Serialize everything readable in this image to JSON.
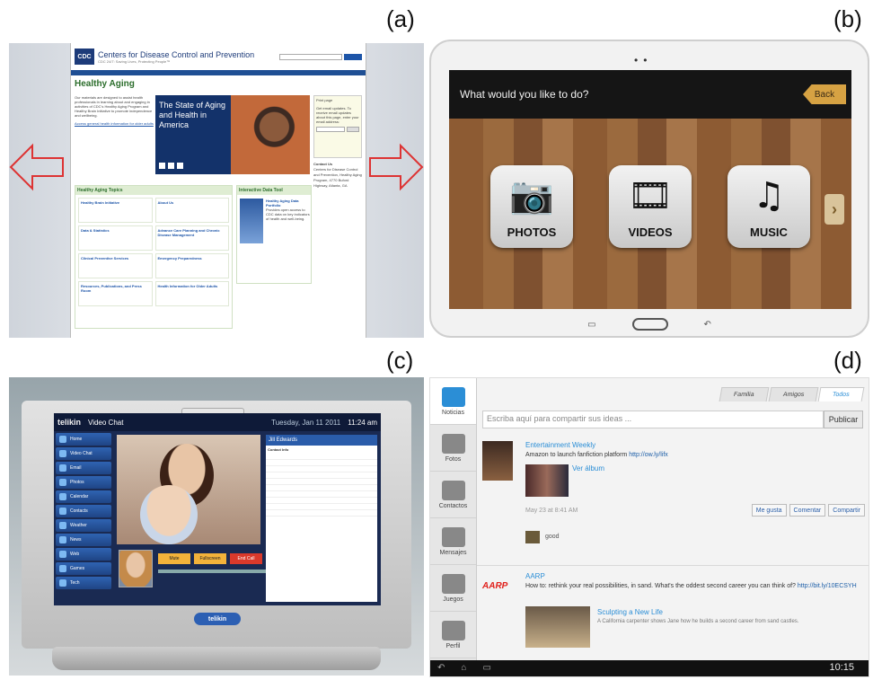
{
  "labels": {
    "a": "(a)",
    "b": "(b)",
    "c": "(c)",
    "d": "(d)"
  },
  "panel_a": {
    "site_title": "Centers for Disease Control and Prevention",
    "tagline": "CDC 24/7: Saving Lives, Protecting People™",
    "logo_text": "CDC",
    "page_heading": "Healthy Aging",
    "banner_title": "The State of Aging and Health in America",
    "topics_heading": "Healthy Aging Topics",
    "tool_heading": "Interactive Data Tool",
    "topics": [
      "Healthy Brain Initiative",
      "About Us",
      "Data & Statistics",
      "Advance Care Planning and Chronic Disease Management",
      "Clinical Preventive Services",
      "Emergency Preparedness",
      "Resources, Publications, and Press Room",
      "Health Information for Older Adults"
    ],
    "tool_item": "Healthy Aging Data Portfolio",
    "side_title": "Print page",
    "side_submit": "Submit",
    "contact_title": "Contact Us"
  },
  "panel_b": {
    "question": "What would you like to do?",
    "back": "Back",
    "tiles": [
      {
        "label": "PHOTOS",
        "glyph": "📷"
      },
      {
        "label": "VIDEOS",
        "glyph": "🎞"
      },
      {
        "label": "MUSIC",
        "glyph": "♫"
      }
    ],
    "next": "›"
  },
  "panel_c": {
    "logo": "telikin",
    "screen_title": "Video Chat",
    "date": "Tuesday, Jan 11 2011",
    "time": "11:24 am",
    "menu": [
      "Home",
      "Video Chat",
      "Email",
      "Photos",
      "Calendar",
      "Contacts",
      "Weather",
      "News",
      "Web",
      "Games",
      "Tech"
    ],
    "buttons": [
      "Mute",
      "Fullscreen",
      "End Call"
    ],
    "contact_name": "Jill Edwards",
    "contact_section": "Contact Info",
    "bottom_logo": "telikin"
  },
  "panel_d": {
    "tabs": [
      "Familia",
      "Amigos",
      "Todos"
    ],
    "compose_placeholder": "Escriba aquí para compartir sus ideas ...",
    "publish": "Publicar",
    "sidebar": [
      "Noticias",
      "Fotos",
      "Contactos",
      "Mensajes",
      "Juegos",
      "Perfil"
    ],
    "post1": {
      "author": "Entertainment Weekly",
      "text": "Amazon to launch fanfiction platform",
      "link": "http://ow.ly/lifx",
      "album": "Ver álbum",
      "date": "May 23 at 8:41 AM",
      "like": "Me gusta",
      "comment": "Comentar",
      "share": "Compartir",
      "comment_text": "good"
    },
    "post2": {
      "logo": "AARP",
      "author": "AARP",
      "text": "How to: rethink your real possibilities, in sand. What's the oddest second career you can think of?",
      "link": "http://bit.ly/10ECSYH",
      "link_title": "Sculpting a New Life",
      "link_desc": "A California carpenter shows Jane how he builds a second career from sand castles."
    },
    "clock": "10:15"
  }
}
